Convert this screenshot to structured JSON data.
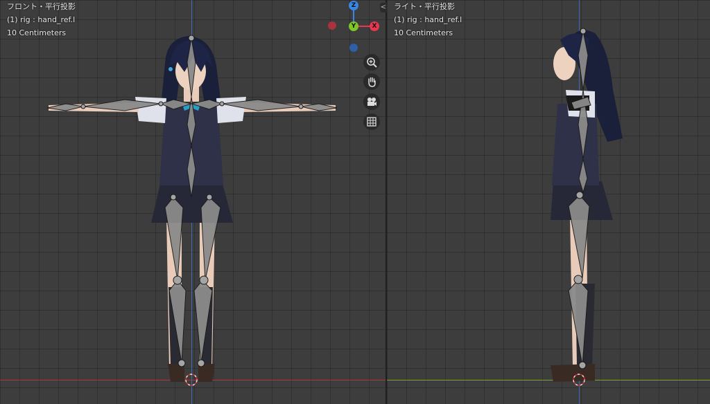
{
  "left_viewport": {
    "view_name": "フロント・平行投影",
    "object_info": "(1) rig : hand_ref.l",
    "scale_label": "10 Centimeters"
  },
  "right_viewport": {
    "view_name": "ライト・平行投影",
    "object_info": "(1) rig : hand_ref.l",
    "scale_label": "10 Centimeters"
  },
  "gizmo": {
    "z_label": "Z",
    "y_label": "Y",
    "x_label": "X",
    "colors": {
      "x": "#e8374f",
      "y": "#7ec528",
      "z": "#3a86e6",
      "neg_x": "#a8323e",
      "neg_z": "#2f5fa6"
    }
  },
  "nav_tools": [
    "zoom-icon",
    "pan-hand-icon",
    "camera-icon",
    "grid-ortho-icon"
  ],
  "split_handle_label": "<>",
  "colors": {
    "grid_bg": "#3d3d3d",
    "x_axis": "#b3353a",
    "y_axis": "#7fa32a",
    "z_axis": "#3f6fc4",
    "bone": "#8b8b8b"
  }
}
